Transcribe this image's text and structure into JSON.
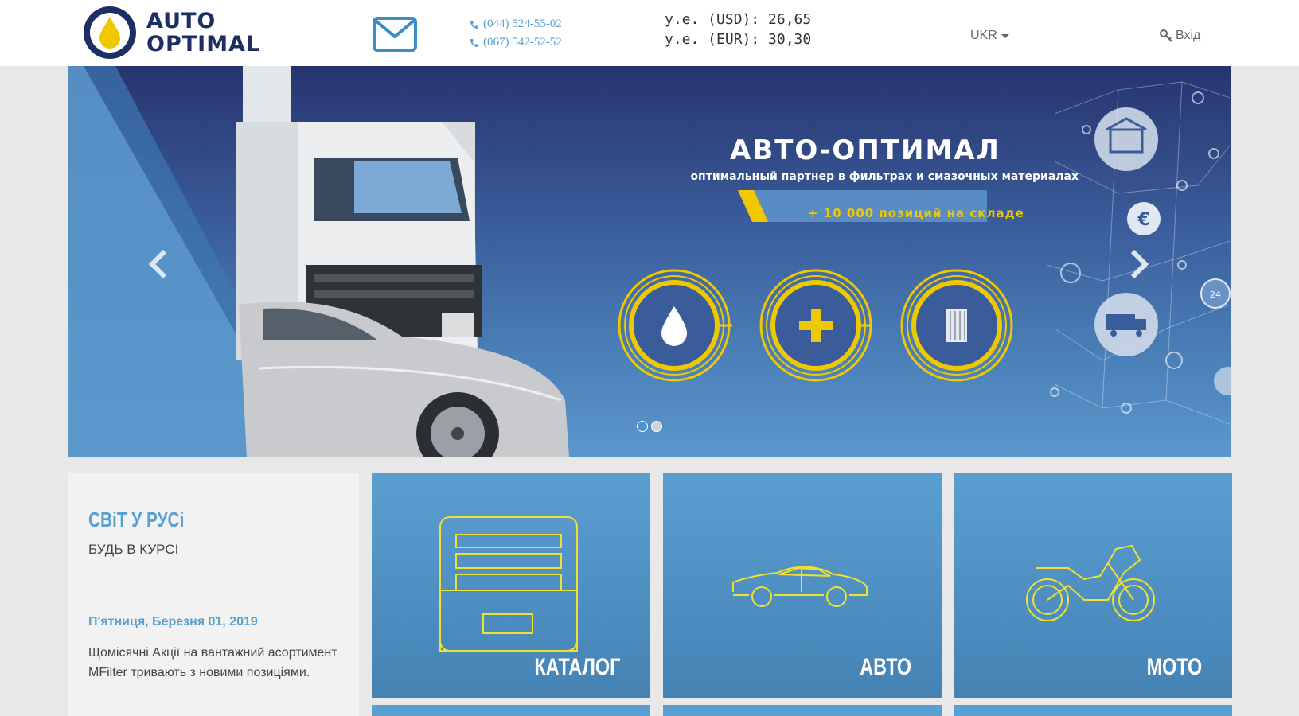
{
  "header": {
    "logo_line1": "AUTO",
    "logo_line2": "OPTIMAL",
    "phones": [
      "(044) 524-55-02",
      "(067) 542-52-52"
    ],
    "rates": [
      "у.е. (USD): 26,65",
      "у.е. (EUR): 30,30"
    ],
    "language": "UKR",
    "login": "Вхід",
    "icons": [
      "mail-icon",
      "phone-icon",
      "key-icon"
    ]
  },
  "slider": {
    "title": "АВТО-ОПТИМАЛ",
    "subtitle": "оптимальный партнер в фильтрах и смазочных материалах",
    "badge": "+ 10 000 позиций на складе",
    "icons": [
      "drop-icon",
      "plus-icon",
      "filter-icon",
      "box-icon",
      "euro-icon",
      "clock-24-icon",
      "truck-icon"
    ],
    "slides": 2,
    "active_slide": 2
  },
  "news": {
    "title": "СВіТ У РУСі",
    "subtitle": "БУДЬ В КУРСІ",
    "date": "П'ятниця, Березня 01, 2019",
    "text": "Щомісячні Акції на вантажний асортимент MFilter тривають з новими позиціями."
  },
  "tiles": [
    {
      "label": "КАТАЛОГ",
      "icon": "catalog-icon"
    },
    {
      "label": "АВТО",
      "icon": "car-icon"
    },
    {
      "label": "МОТО",
      "icon": "motorcycle-icon"
    }
  ],
  "colors": {
    "brand_dark": "#1c2e63",
    "brand_yellow": "#f0c800",
    "accent_blue": "#5a9fd0"
  }
}
